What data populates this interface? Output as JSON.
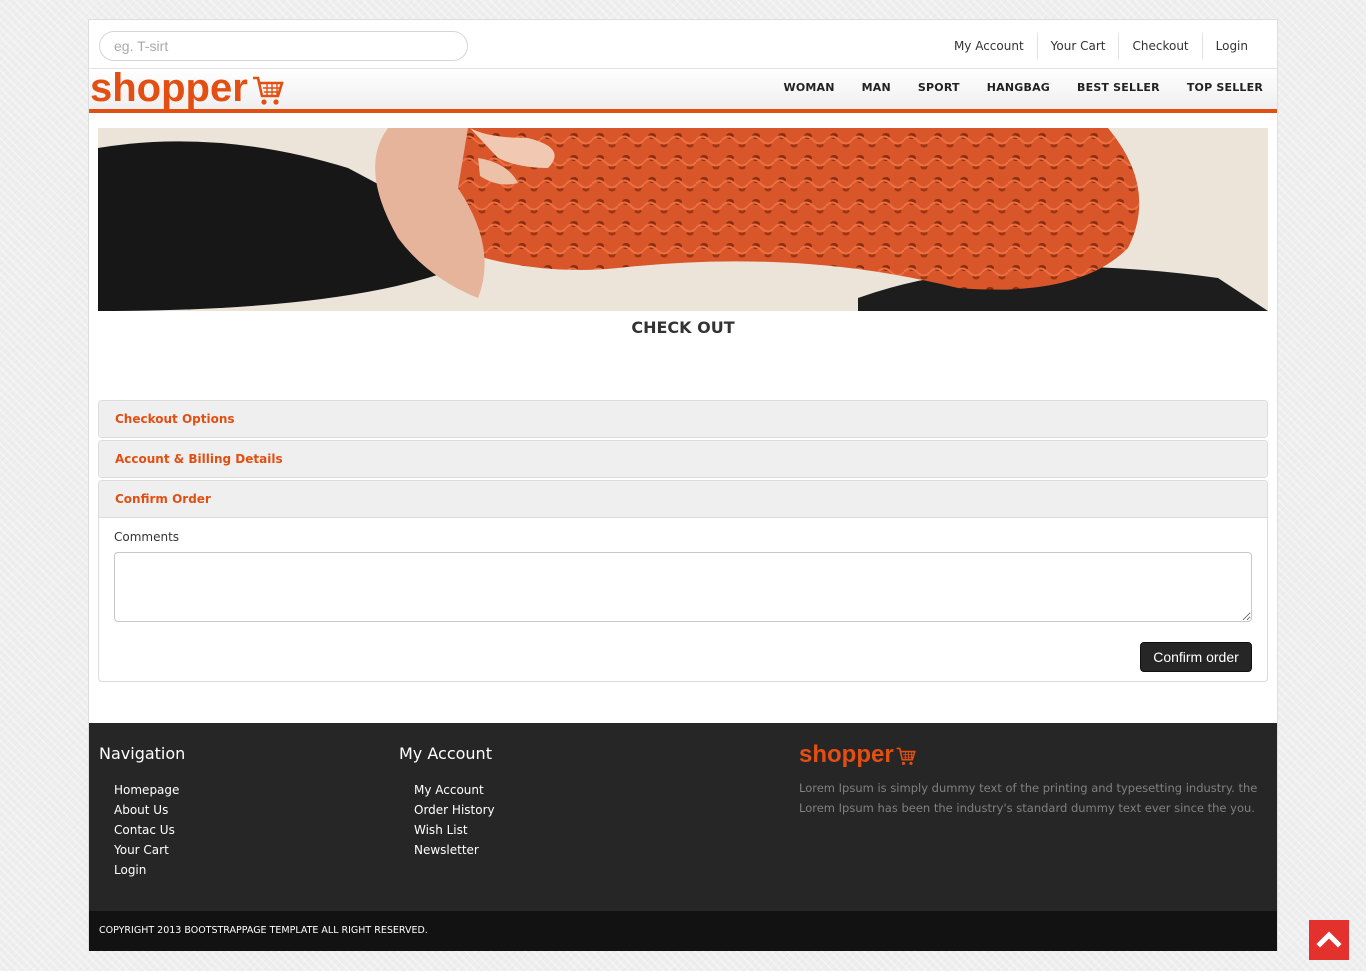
{
  "search": {
    "placeholder": "eg. T-sirt"
  },
  "toplinks": [
    "My Account",
    "Your Cart",
    "Checkout",
    "Login"
  ],
  "logo": {
    "text": "shopper",
    "icon": "cart-icon"
  },
  "nav": [
    "WOMAN",
    "MAN",
    "SPORT",
    "HANGBAG",
    "BEST SELLER",
    "TOP SELLER"
  ],
  "page_title": "CHECK OUT",
  "accordion": [
    {
      "title": "Checkout Options"
    },
    {
      "title": "Account & Billing Details"
    },
    {
      "title": "Confirm Order"
    }
  ],
  "confirm": {
    "comments_label": "Comments",
    "comments_value": "",
    "button": "Confirm order"
  },
  "footer": {
    "nav_title": "Navigation",
    "nav_links": [
      "Homepage",
      "About Us",
      "Contac Us",
      "Your Cart",
      "Login"
    ],
    "account_title": "My Account",
    "account_links": [
      "My Account",
      "Order History",
      "Wish List",
      "Newsletter"
    ],
    "logo_text": "shopper",
    "description": "Lorem Ipsum is simply dummy text of the printing and typesetting industry. the Lorem Ipsum has been the industry's standard dummy text ever since the you.",
    "copyright": "COPYRIGHT 2013 BOOTSTRAPPAGE TEMPLATE ALL RIGHT RESERVED."
  },
  "scroll_top": {
    "icon": "chevron-up-icon"
  },
  "colors": {
    "accent": "#e34f12",
    "footer_bg": "#262626",
    "copyright_bg": "#121212",
    "scroll_top_bg": "#e3312d"
  }
}
